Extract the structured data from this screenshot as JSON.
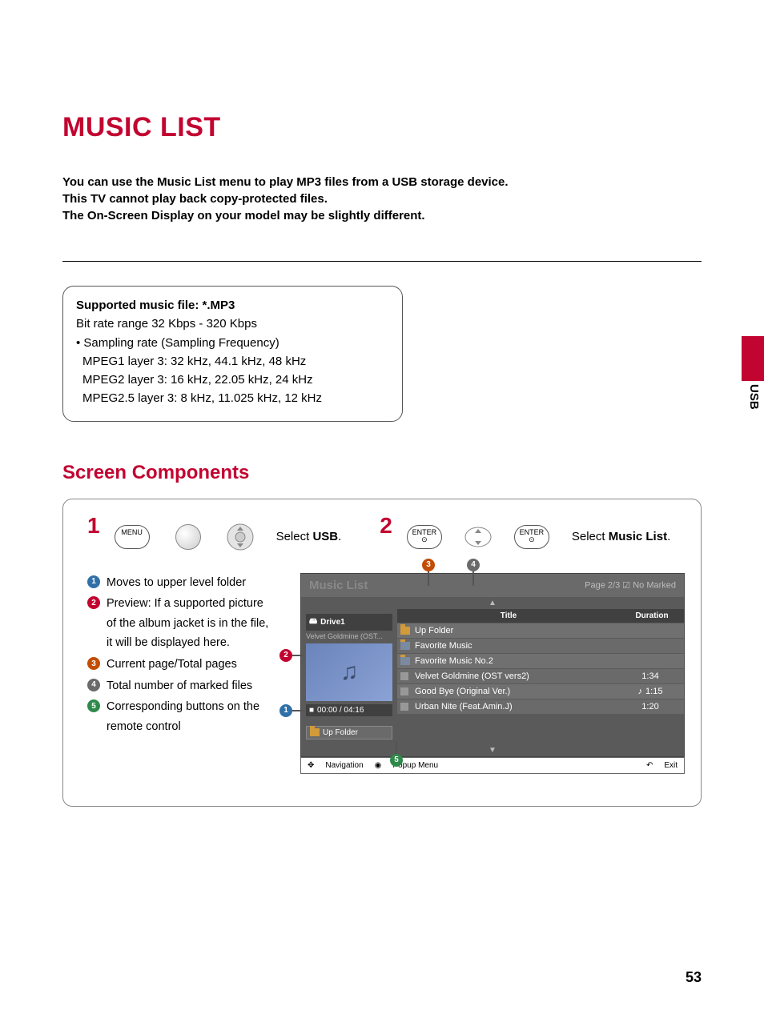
{
  "page_title": "MUSIC LIST",
  "side_label": "USB",
  "intro": {
    "l1": "You can use the Music List menu to play MP3 files from a USB storage device.",
    "l2": "This TV cannot play back copy-protected files.",
    "l3": "The On-Screen Display on your model may be slightly different."
  },
  "box": {
    "heading": "Supported music file: *.MP3",
    "bitrate": "Bit rate range 32 Kbps - 320 Kbps",
    "bullet": "• Sampling rate (Sampling Frequency)",
    "m1": "MPEG1 layer 3: 32 kHz, 44.1 kHz, 48 kHz",
    "m2": "MPEG2 layer 3: 16 kHz, 22.05  kHz, 24 kHz",
    "m3": "MPEG2.5 layer 3: 8 kHz, 11.025 kHz, 12 kHz"
  },
  "section_heading": "Screen Components",
  "steps": {
    "s1_btn": "MENU",
    "s1_prefix": "Select ",
    "s1_bold": "USB",
    "s1_dot": ".",
    "s2_btn": "ENTER",
    "s2_prefix": "Select ",
    "s2_bold": "Music List",
    "s2_dot": "."
  },
  "legend": {
    "i1": "Moves to upper level folder",
    "i2": "Preview: If a supported picture of the album jacket is in the file, it will be displayed here.",
    "i3": "Current page/Total pages",
    "i4": "Total number of marked files",
    "i5": "Corresponding buttons on the remote control"
  },
  "tv": {
    "title": "Music List",
    "page": "Page 2/3",
    "marked": "No Marked",
    "drive": "Drive1",
    "subtitle": "Velvet Goldmine (OST...",
    "playtime": "00:00 / 04:16",
    "upfolder": "Up Folder",
    "col_title": "Title",
    "col_duration": "Duration",
    "rows": [
      {
        "type": "up",
        "title": "Up Folder",
        "dur": ""
      },
      {
        "type": "folder",
        "title": "Favorite Music",
        "dur": ""
      },
      {
        "type": "folder",
        "title": "Favorite Music No.2",
        "dur": ""
      },
      {
        "type": "track",
        "title": "Velvet Goldmine (OST vers2)",
        "dur": "1:34"
      },
      {
        "type": "track",
        "title": "Good Bye (Original Ver.)",
        "dur": "1:15",
        "playing": true
      },
      {
        "type": "track",
        "title": "Urban Nite (Feat.Amin.J)",
        "dur": "1:20"
      }
    ],
    "footer": {
      "nav": "Navigation",
      "popup": "Popup Menu",
      "exit": "Exit"
    }
  },
  "callouts": {
    "c1": "1",
    "c2": "2",
    "c3": "3",
    "c4": "4",
    "c5": "5"
  },
  "pagenum": "53"
}
